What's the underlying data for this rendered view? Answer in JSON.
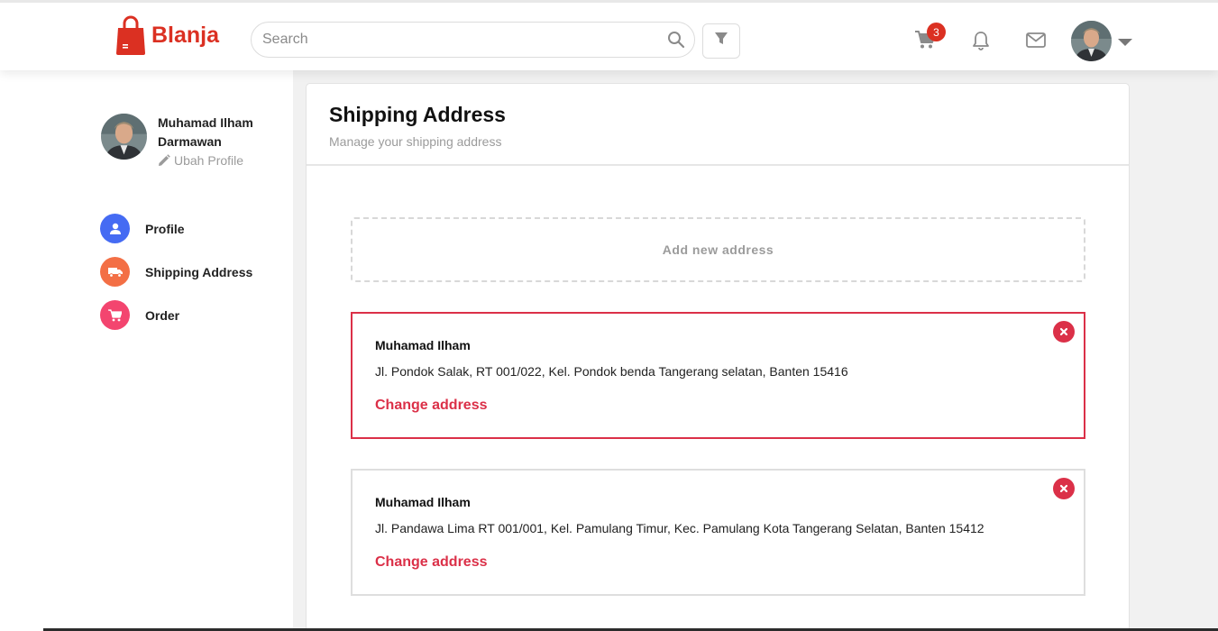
{
  "brand": {
    "name": "Blanja",
    "color": "#db3022",
    "accent": "#db3048"
  },
  "header": {
    "search_placeholder": "Search",
    "cart_count": "3",
    "icons": [
      "search-icon",
      "filter-icon",
      "cart-icon",
      "bell-icon",
      "mail-icon",
      "avatar",
      "chevron-down-icon"
    ]
  },
  "sidebar": {
    "user_name": "Muhamad Ilham Darmawan",
    "edit_label": "Ubah Profile",
    "items": [
      {
        "label": "Profile",
        "icon": "user-icon",
        "color": "#456bf3"
      },
      {
        "label": "Shipping Address",
        "icon": "truck-icon",
        "color": "#f36f45"
      },
      {
        "label": "Order",
        "icon": "cart-icon",
        "color": "#f3456f"
      }
    ]
  },
  "main": {
    "title": "Shipping Address",
    "subtitle": "Manage your shipping address",
    "add_label": "Add new address",
    "addresses": [
      {
        "name": "Muhamad Ilham",
        "address": "Jl. Pondok Salak, RT 001/022, Kel. Pondok benda Tangerang selatan, Banten 15416",
        "change_label": "Change address",
        "selected": true
      },
      {
        "name": "Muhamad Ilham",
        "address": "Jl. Pandawa Lima RT 001/001, Kel. Pamulang Timur, Kec. Pamulang Kota Tangerang Selatan, Banten 15412",
        "change_label": "Change address",
        "selected": false
      }
    ]
  }
}
